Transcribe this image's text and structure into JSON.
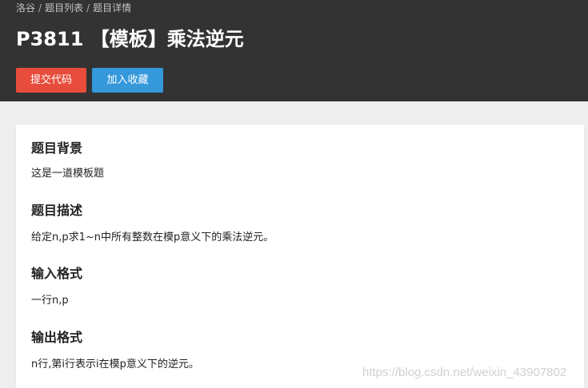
{
  "breadcrumb": {
    "items": [
      "洛谷",
      "题目列表",
      "题目详情"
    ],
    "separator": "/"
  },
  "problem": {
    "title": "P3811 【模板】乘法逆元"
  },
  "actions": {
    "submit_label": "提交代码",
    "favorite_label": "加入收藏"
  },
  "sections": [
    {
      "title": "题目背景",
      "text": "这是一道模板题"
    },
    {
      "title": "题目描述",
      "text": "给定n,p求1~n中所有整数在模p意义下的乘法逆元。"
    },
    {
      "title": "输入格式",
      "text": "一行n,p"
    },
    {
      "title": "输出格式",
      "text": "n行,第i行表示i在模p意义下的逆元。"
    }
  ],
  "watermark": "https://blog.csdn.net/weixin_43907802",
  "colors": {
    "header_bg": "#333333",
    "submit_bg": "#e74c3c",
    "favorite_bg": "#3498db",
    "page_bg": "#eeeeee"
  }
}
